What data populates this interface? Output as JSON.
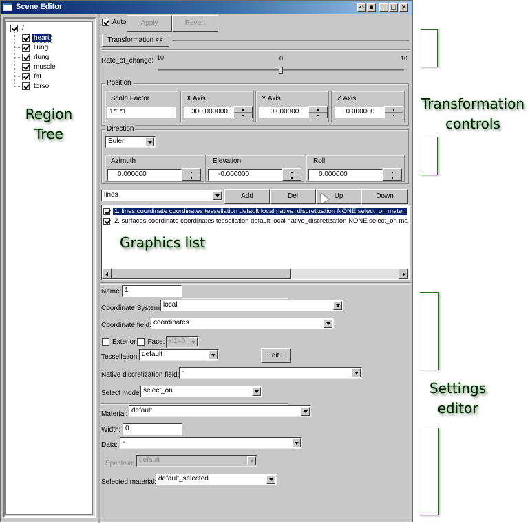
{
  "window": {
    "title": "Scene Editor",
    "title_buttons": [
      "dock-toggle",
      "float",
      "minimize",
      "maximize",
      "close"
    ]
  },
  "region_tree": {
    "root": {
      "label": "/",
      "checked": true
    },
    "items": [
      {
        "label": "heart",
        "checked": true,
        "selected": true
      },
      {
        "label": "llung",
        "checked": true,
        "selected": false
      },
      {
        "label": "rlung",
        "checked": true,
        "selected": false
      },
      {
        "label": "muscle",
        "checked": true,
        "selected": false
      },
      {
        "label": "fat",
        "checked": true,
        "selected": false
      },
      {
        "label": "torso",
        "checked": true,
        "selected": false
      }
    ]
  },
  "toolbar": {
    "auto_label": "Auto",
    "auto_checked": true,
    "apply_label": "Apply",
    "revert_label": "Revert",
    "transformation_toggle_label": "Transformation <<"
  },
  "transformation": {
    "rate_label": "Rate_of_change:",
    "rate_min": "-10",
    "rate_mid": "0",
    "rate_max": "10",
    "rate_value": 0,
    "position": {
      "title": "Position",
      "scale_factor_label": "Scale Factor",
      "scale_factor_value": "1*1*1",
      "x_label": "X Axis",
      "x_value": "300.000000",
      "y_label": "Y Axis",
      "y_value": "0.000000",
      "z_label": "Z Axis",
      "z_value": "0.000000"
    },
    "direction": {
      "title": "Direction",
      "mode": "Euler",
      "azimuth_label": "Azimuth",
      "azimuth_value": "0.000000",
      "elevation_label": "Elevation",
      "elevation_value": "-0.000000",
      "roll_label": "Roll",
      "roll_value": "0.000000"
    }
  },
  "graphics": {
    "type_value": "lines",
    "add_label": "Add",
    "del_label": "Del",
    "up_label": "Up",
    "down_label": "Down",
    "items": [
      {
        "text": "1. lines coordinate coordinates tessellation default local native_discretization NONE select_on materi",
        "checked": true,
        "selected": true
      },
      {
        "text": "2. surfaces coordinate coordinates tessellation default local native_discretization NONE select_on ma",
        "checked": true,
        "selected": false
      }
    ]
  },
  "settings": {
    "name_label": "Name:",
    "name_value": "1",
    "coordinate_system_label": "Coordinate System:",
    "coordinate_system_value": "local",
    "coordinate_field_label": "Coordinate field:",
    "coordinate_field_value": "coordinates",
    "exterior_label": "Exterior",
    "exterior_checked": false,
    "face_label": "Face:",
    "face_checked": false,
    "face_value": "xi1=0",
    "tessellation_label": "Tessellation:",
    "tessellation_value": "default",
    "edit_label": "Edit...",
    "native_discretization_label": "Native discretization field:",
    "native_discretization_value": "-",
    "select_mode_label": "Select mode:",
    "select_mode_value": "select_on",
    "material_label": "Material:",
    "material_value": "default",
    "width_label": "Width:",
    "width_value": "0",
    "data_label": "Data:",
    "data_value": "-",
    "spectrum_label": "Spectrum:",
    "spectrum_value": "default",
    "selected_material_label": "Selected material:",
    "selected_material_value": "default_selected"
  },
  "annotations": {
    "region_tree": [
      "Region",
      "Tree"
    ],
    "graphics_list": "Graphics list",
    "transformation_controls": [
      "Transformation",
      "controls"
    ],
    "settings_editor": [
      "Settings",
      "editor"
    ],
    "color": "#2b6b1f"
  }
}
